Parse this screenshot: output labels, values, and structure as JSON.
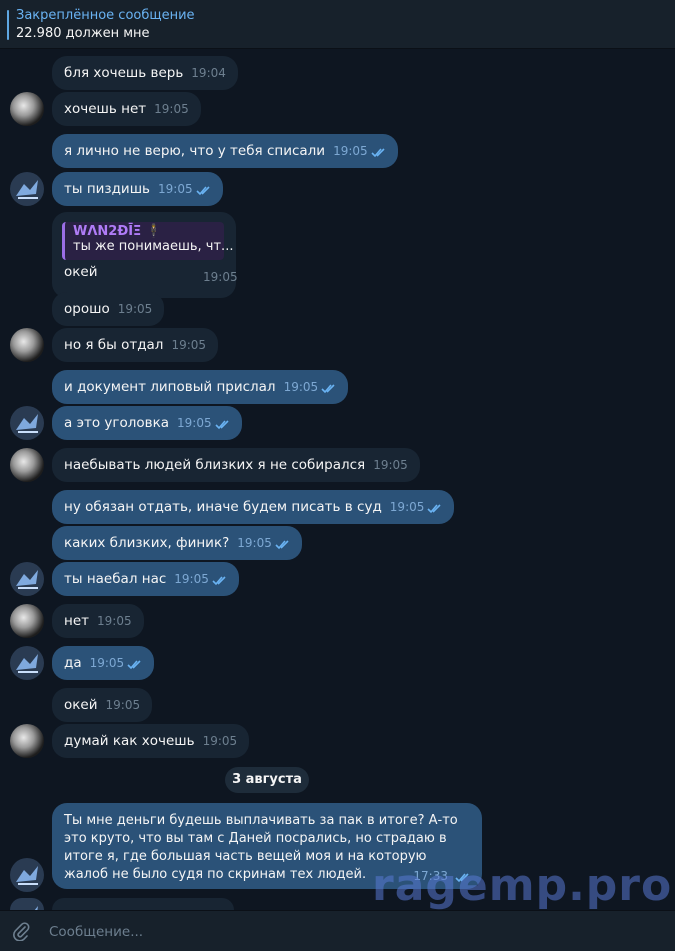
{
  "pinned": {
    "title": "Закреплённое сообщение",
    "text": "22.980 должен мне"
  },
  "messages": [
    {
      "text": "бля хочешь верь",
      "time": "19:04"
    },
    {
      "text": "хочешь нет",
      "time": "19:05"
    },
    {
      "text": "я лично не верю, что у тебя списали",
      "time": "19:05"
    },
    {
      "text": "ты пиздишь",
      "time": "19:05"
    },
    {
      "reply_name": "WΛN2ÐĪΞ 🕴",
      "reply_text": "ты же понимаешь, чт...",
      "text": "окей",
      "time": "19:05"
    },
    {
      "text": "орошо",
      "time": "19:05"
    },
    {
      "text": "но я бы отдал",
      "time": "19:05"
    },
    {
      "text": "и документ липовый прислал",
      "time": "19:05"
    },
    {
      "text": "а это уголовка",
      "time": "19:05"
    },
    {
      "text": "наебывать людей близких я не собирался",
      "time": "19:05"
    },
    {
      "text": "ну обязан отдать, иначе будем писать в суд",
      "time": "19:05"
    },
    {
      "text": "каких близких, финик?",
      "time": "19:05"
    },
    {
      "text": "ты наебал нас",
      "time": "19:05"
    },
    {
      "text": "нет",
      "time": "19:05"
    },
    {
      "text": "да",
      "time": "19:05"
    },
    {
      "text": "окей",
      "time": "19:05"
    },
    {
      "text": "думай как хочешь",
      "time": "19:05"
    }
  ],
  "date_separator": "3 августа",
  "last_message": {
    "text": "Ты мне деньги будешь выплачивать за пак в итоге? А-то это круто, что вы там с Даней посрались, но страдаю в итоге я, где большая часть вещей моя и на которую жалоб не было судя по скринам тех людей.",
    "time": "17:33"
  },
  "watermark": "ragemp.pro",
  "composer": {
    "placeholder": "Сообщение..."
  },
  "colors": {
    "bg": "#0e1621",
    "incoming": "#182533",
    "outgoing": "#2b5278",
    "accent": "#6ab3f3"
  },
  "icons": [
    "paperclip-icon",
    "double-check-icon",
    "avatar"
  ]
}
